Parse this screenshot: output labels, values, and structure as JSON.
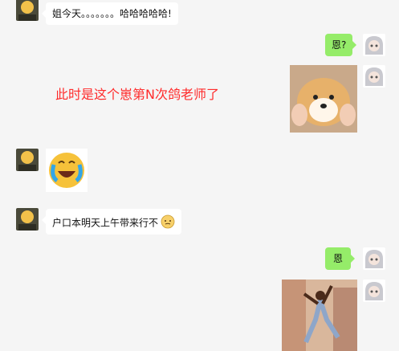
{
  "messages": [
    {
      "side": "left",
      "type": "text",
      "text": "姐今天。。。。。。。哈哈哈哈哈!"
    },
    {
      "side": "right",
      "type": "text",
      "text": "恩?"
    },
    {
      "side": "right",
      "type": "image",
      "image": "shiba-dog-face-squished-photo"
    },
    {
      "side": "left",
      "type": "sticker",
      "image": "crying-laughing-emoji-sticker"
    },
    {
      "side": "left",
      "type": "text",
      "text": "户口本明天上午带来行不",
      "trailing_emoji": "awkward-emoji"
    },
    {
      "side": "right",
      "type": "text",
      "text": "恩"
    },
    {
      "side": "right",
      "type": "image",
      "image": "dancing-man-photo"
    }
  ],
  "overlay_caption": "此时是这个崽第N次鸽老师了",
  "colors": {
    "background": "#f5f5f5",
    "incoming_bubble": "#ffffff",
    "outgoing_bubble": "#95ec69",
    "overlay_text": "#ff2b2b"
  }
}
